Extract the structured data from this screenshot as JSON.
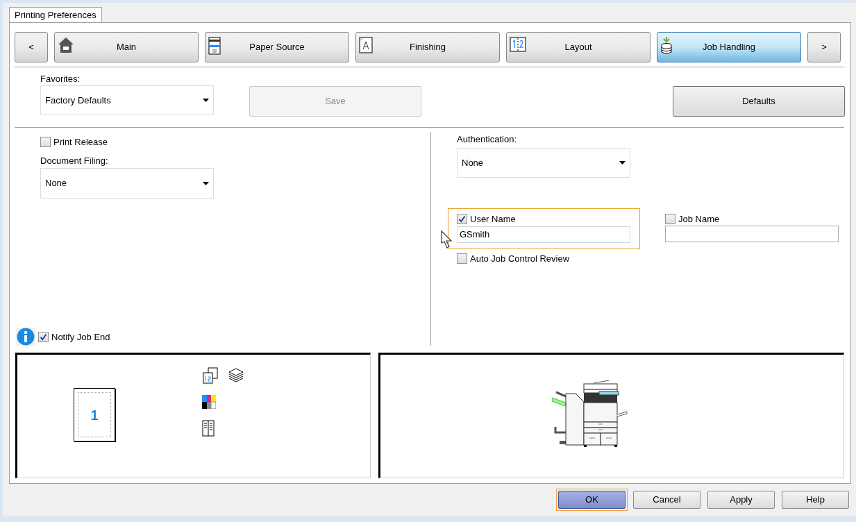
{
  "dialog_tab": {
    "label": "Printing Preferences",
    "selected": true
  },
  "nav": {
    "prev": "<",
    "next": ">",
    "tabs": [
      {
        "label": "Main",
        "kind": "home",
        "selected": false
      },
      {
        "label": "Paper Source",
        "kind": "paper",
        "selected": false
      },
      {
        "label": "Finishing",
        "kind": "finishing",
        "selected": false
      },
      {
        "label": "Layout",
        "kind": "layout",
        "selected": false
      },
      {
        "label": "Job Handling",
        "kind": "job",
        "selected": true
      }
    ]
  },
  "favorites": {
    "label": "Favorites:",
    "value": "Factory Defaults"
  },
  "save_button": {
    "label": "Save",
    "disabled": true
  },
  "defaults_button": {
    "label": "Defaults",
    "disabled": false
  },
  "print_release": {
    "label": "Print Release",
    "checked": false
  },
  "document_filing": {
    "label": "Document Filing:",
    "value": "None"
  },
  "authentication": {
    "label": "Authentication:",
    "value": "None"
  },
  "user_name": {
    "label": "User Name",
    "checked": true,
    "value": "GSmith",
    "focused": true
  },
  "job_name": {
    "label": "Job Name",
    "checked": false
  },
  "auto_job_control_review": {
    "label": "Auto Job Control Review",
    "checked": false
  },
  "notify_job_end": {
    "label": "Notify Job End",
    "checked": true
  },
  "preview": {
    "page_number": "1"
  },
  "buttons": [
    {
      "label": "OK",
      "default": true
    },
    {
      "label": "Cancel",
      "default": false
    },
    {
      "label": "Apply",
      "default": false
    },
    {
      "label": "Help",
      "default": false
    }
  ]
}
